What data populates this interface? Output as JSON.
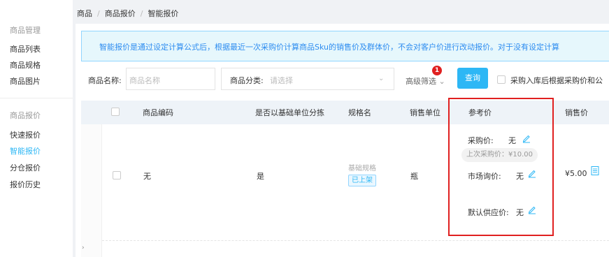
{
  "breadcrumb": [
    "商品",
    "商品报价",
    "智能报价"
  ],
  "sidebar": {
    "group1": {
      "title": "商品管理",
      "items": [
        "商品列表",
        "商品规格",
        "商品图片"
      ]
    },
    "group2": {
      "title": "商品报价",
      "items": [
        "快速报价",
        "智能报价",
        "分仓报价",
        "报价历史"
      ]
    },
    "active_item": "智能报价"
  },
  "notice": "智能报价是通过设定计算公式后，根据最近一次采购价计算商品Sku的销售价及群体价，不会对客户价进行改动报价。对于没有设定计算",
  "filters": {
    "name_label": "商品名称:",
    "name_placeholder": "商品名称",
    "category_label": "商品分类:",
    "category_placeholder": "请选择",
    "advanced_label": "高级筛选",
    "advanced_badge": "1",
    "query_button": "查询",
    "sync_label": "采购入库后根据采购价和公"
  },
  "table": {
    "headers": [
      "商品编码",
      "是否以基础单位分拣",
      "规格名",
      "销售单位",
      "参考价",
      "销售价"
    ],
    "rows": [
      {
        "code": "无",
        "split_by_base": "是",
        "spec_name": "基础规格",
        "spec_status": "已上架",
        "unit": "瓶",
        "purchase_price_label": "采购价:",
        "purchase_price": "无",
        "last_purchase": "上次采购价：¥10.00",
        "market_price_label": "市场询价:",
        "market_price": "无",
        "supplier_price_label": "默认供应价:",
        "supplier_price": "无",
        "sale_price": "¥5.00"
      }
    ]
  },
  "colors": {
    "accent": "#2db7f5",
    "highlight": "#e02020",
    "notice_text": "#2d8cf0"
  },
  "footer_mark": "›"
}
